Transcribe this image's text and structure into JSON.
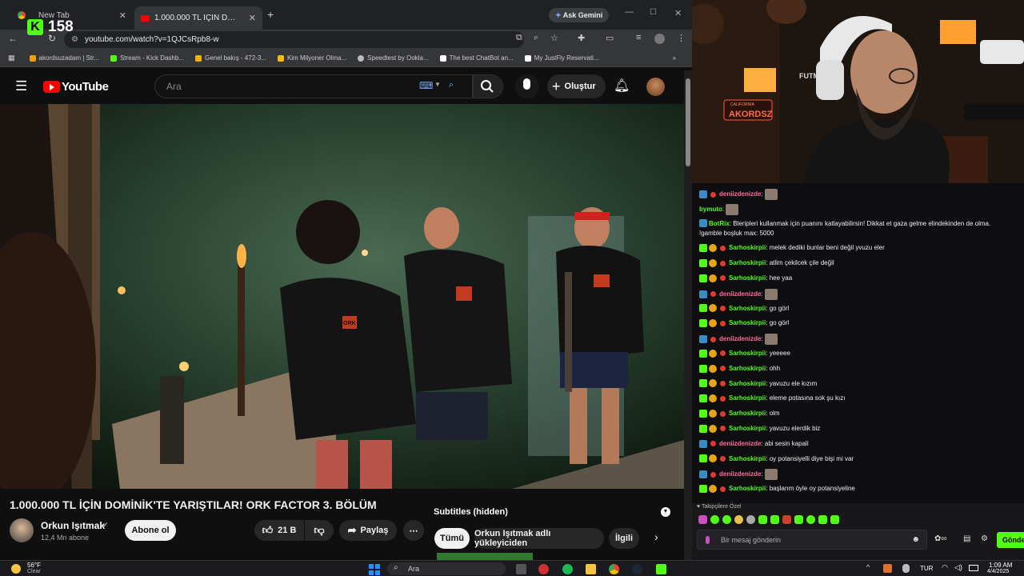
{
  "browser": {
    "tabs": [
      {
        "label": "New Tab"
      },
      {
        "label": "1.000.000 TL İÇİN DOMİNİK"
      }
    ],
    "ask_gemini": "Ask Gemini",
    "overlay_counter": "158",
    "url": "youtube.com/watch?v=1QJCsRpb8-w",
    "bookmarks": [
      {
        "label": "akordsuzadam | Str...",
        "color": "#f0a000"
      },
      {
        "label": "Stream - Kick Dashb...",
        "color": "#53fc18"
      },
      {
        "label": "Genel bakış - 472-3...",
        "color": "#f4b400"
      },
      {
        "label": "Kim Milyoner Olma...",
        "color": "#fbbc04"
      },
      {
        "label": "Speedtest by Ookla...",
        "color": "#bbbbbb"
      },
      {
        "label": "The best ChatBot an...",
        "color": "#ffffff"
      },
      {
        "label": "My JustFly Reservati...",
        "color": "#ffffff"
      }
    ]
  },
  "youtube": {
    "logo_text": "YouTube",
    "search_placeholder": "Ara",
    "create_label": "Oluştur",
    "video_title": "1.000.000 TL İÇİN DOMİNİK'TE YARIŞTILAR! ORK FACTOR 3. BÖLÜM",
    "channel_name": "Orkun Işıtmak",
    "subscribers": "12,4 Mn abone",
    "subscribe_label": "Abone ol",
    "likes": "21 B",
    "share_label": "Paylaş",
    "subtitles_label": "Subtitles (hidden)",
    "chips": [
      "Tümü",
      "Orkun Işıtmak adlı yükleyiciden",
      "İlgili"
    ],
    "video_logo_text": "ORK"
  },
  "stream": {
    "headset_brand": "FUTMAX",
    "neon_sign": "AKORDSZ",
    "neon_sub": "CALIFORNIA"
  },
  "chat": {
    "messages": [
      {
        "user": "deniizdenizde",
        "text": "",
        "color": "#ff6b9d",
        "emote": true
      },
      {
        "user": "bymuto",
        "text": "",
        "color": "#53fc18",
        "emote": true
      },
      {
        "user": "BotRix",
        "text": "Bleripleri kullanmak için puanını katlayabilirsin! Dikkat et gaza gelme elindekinden de olma.",
        "text2": "!gamble boşluk max: 5000",
        "color": "#53fc18"
      },
      {
        "user": "Sarhoskirpii",
        "text": "melek dediki bunlar beni değil yvuzu eler",
        "color": "#53fc18"
      },
      {
        "user": "Sarhoskirpii",
        "text": "atlim çekilcek çile değil",
        "color": "#53fc18"
      },
      {
        "user": "Sarhoskirpii",
        "text": "hee yaa",
        "color": "#53fc18"
      },
      {
        "user": "deniizdenizde",
        "text": "",
        "color": "#ff6b9d",
        "emote": true
      },
      {
        "user": "Sarhoskirpii",
        "text": "go görl",
        "color": "#53fc18"
      },
      {
        "user": "Sarhoskirpii",
        "text": "go görl",
        "color": "#53fc18"
      },
      {
        "user": "deniizdenizde",
        "text": "",
        "color": "#ff6b9d",
        "emote": true
      },
      {
        "user": "Sarhoskirpii",
        "text": "yeeeee",
        "color": "#53fc18"
      },
      {
        "user": "Sarhoskirpii",
        "text": "ohh",
        "color": "#53fc18"
      },
      {
        "user": "Sarhoskirpii",
        "text": "yavuzu ele kızım",
        "color": "#53fc18"
      },
      {
        "user": "Sarhoskirpii",
        "text": "eleme potasına sok şu kızı",
        "color": "#53fc18"
      },
      {
        "user": "Sarhoskirpii",
        "text": "olm",
        "color": "#53fc18"
      },
      {
        "user": "Sarhoskirpii",
        "text": "yavuzu elerdik biz",
        "color": "#53fc18"
      },
      {
        "user": "deniizdenizde",
        "text": "abi sesin kapali",
        "color": "#ff6b9d"
      },
      {
        "user": "Sarhoskirpii",
        "text": "oy potansiyelli diye bişi mi var",
        "color": "#53fc18"
      },
      {
        "user": "deniizdenizde",
        "text": "",
        "color": "#ff6b9d",
        "emote": true
      },
      {
        "user": "Sarhoskirpii",
        "text": "başlarım öyle oy potansiyeline",
        "color": "#53fc18"
      }
    ],
    "followers_label": "Takipçilere Özel",
    "input_placeholder": "Bir mesaj gönderin",
    "send_label": "Gönder"
  },
  "taskbar": {
    "temperature": "56°F",
    "weather": "Clear",
    "search_label": "Ara",
    "language": "TUR",
    "time": "1:09 AM",
    "date": "4/4/2025"
  }
}
